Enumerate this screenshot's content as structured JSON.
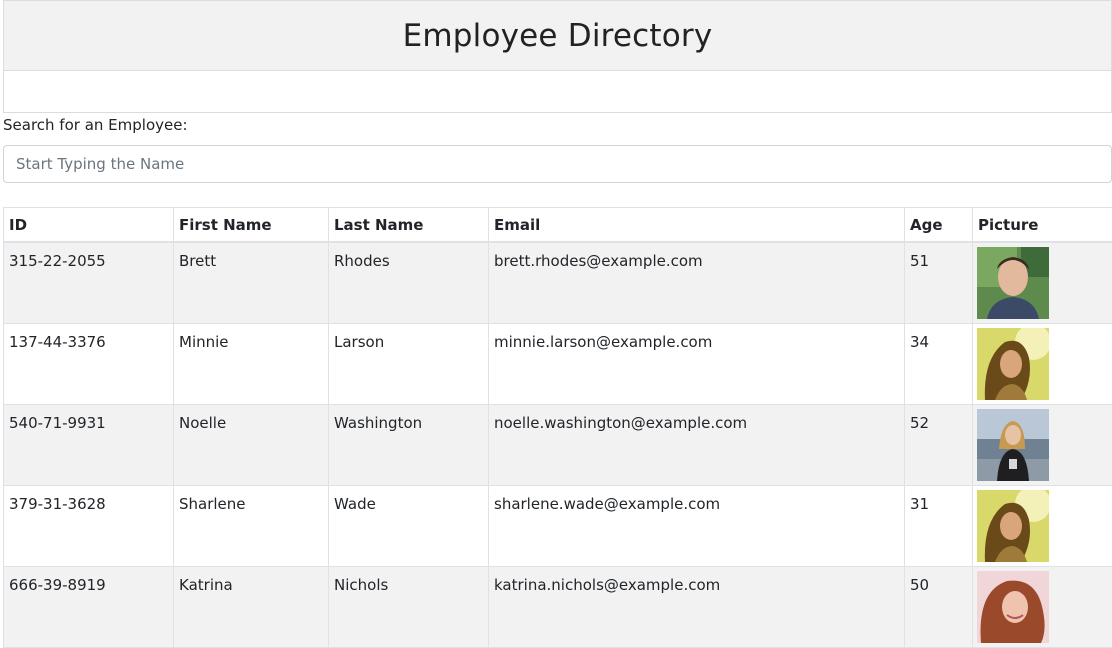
{
  "header": {
    "title": "Employee Directory"
  },
  "search": {
    "label": "Search for an Employee:",
    "placeholder": "Start Typing the Name",
    "value": ""
  },
  "table": {
    "columns": [
      "ID",
      "First Name",
      "Last Name",
      "Email",
      "Age",
      "Picture"
    ],
    "rows": [
      {
        "id": "315-22-2055",
        "first": "Brett",
        "last": "Rhodes",
        "email": "brett.rhodes@example.com",
        "age": "51",
        "picture": "male-portrait-photo"
      },
      {
        "id": "137-44-3376",
        "first": "Minnie",
        "last": "Larson",
        "email": "minnie.larson@example.com",
        "age": "34",
        "picture": "female-portrait-photo"
      },
      {
        "id": "540-71-9931",
        "first": "Noelle",
        "last": "Washington",
        "email": "noelle.washington@example.com",
        "age": "52",
        "picture": "female-portrait-photo"
      },
      {
        "id": "379-31-3628",
        "first": "Sharlene",
        "last": "Wade",
        "email": "sharlene.wade@example.com",
        "age": "31",
        "picture": "female-portrait-photo"
      },
      {
        "id": "666-39-8919",
        "first": "Katrina",
        "last": "Nichols",
        "email": "katrina.nichols@example.com",
        "age": "50",
        "picture": "female-portrait-photo"
      }
    ]
  }
}
